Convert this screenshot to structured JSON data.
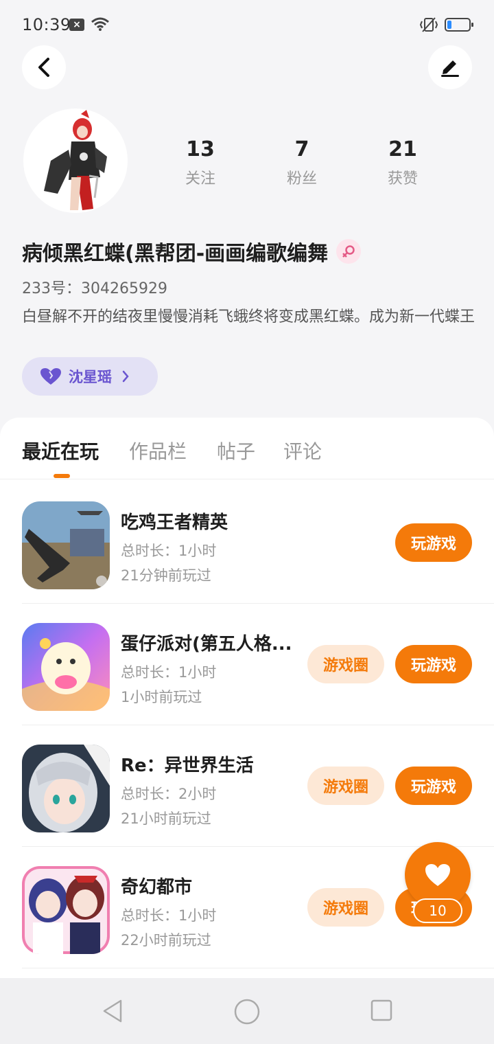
{
  "status_bar": {
    "time": "10:39"
  },
  "profile": {
    "stats": [
      {
        "value": "13",
        "label": "关注"
      },
      {
        "value": "7",
        "label": "粉丝"
      },
      {
        "value": "21",
        "label": "获赞"
      }
    ],
    "nickname": "病倾黑红蝶(黑帮团-画画编歌编舞",
    "user_id": "233号：304265929",
    "bio": "白昼解不开的结夜里慢慢消耗飞蛾终将变成黑红蝶。成为新一代蝶王",
    "tag": {
      "label": "沈星瑶"
    }
  },
  "tabs": [
    {
      "label": "最近在玩",
      "active": true
    },
    {
      "label": "作品栏",
      "active": false
    },
    {
      "label": "帖子",
      "active": false
    },
    {
      "label": "评论",
      "active": false
    }
  ],
  "games": [
    {
      "name": "吃鸡王者精英",
      "duration": "总时长：1小时",
      "last_played": "21分钟前玩过",
      "circle_label": "",
      "play_label": "玩游戏"
    },
    {
      "name": "蛋仔派对(第五人格...",
      "duration": "总时长：1小时",
      "last_played": "1小时前玩过",
      "circle_label": "游戏圈",
      "play_label": "玩游戏"
    },
    {
      "name": "Re：异世界生活",
      "duration": "总时长：2小时",
      "last_played": "21小时前玩过",
      "circle_label": "游戏圈",
      "play_label": "玩游戏"
    },
    {
      "name": "奇幻都市",
      "duration": "总时长：1小时",
      "last_played": "22小时前玩过",
      "circle_label": "游戏圈",
      "play_label": "玩游戏"
    }
  ],
  "like_fab": {
    "count": "10"
  },
  "colors": {
    "accent": "#f47a0a",
    "accent_light": "#fde8d6",
    "tag_bg": "#e3e1f5",
    "tag_text": "#6a55d0"
  }
}
